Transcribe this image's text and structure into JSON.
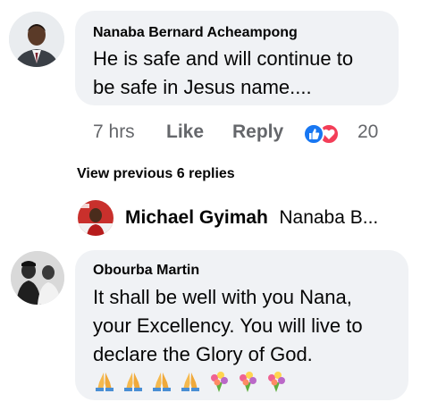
{
  "comment1": {
    "author": "Nanaba Bernard Acheampong",
    "line1": "He is safe and will continue to",
    "line2": "be safe in Jesus name....",
    "time": "7 hrs",
    "like": "Like",
    "reply": "Reply",
    "reaction_count": "20",
    "reaction_icons": [
      "like-icon",
      "love-icon"
    ]
  },
  "view_previous": "View previous 6 replies",
  "reply_preview": {
    "author": "Michael Gyimah",
    "snippet": "Nanaba B..."
  },
  "comment2": {
    "author": "Obourba Martin",
    "line1": "It shall be well with you Nana,",
    "line2": "your Excellency. You will live to",
    "line3": "declare the Glory of God.",
    "emojis": [
      "folded-hands",
      "folded-hands",
      "folded-hands",
      "folded-hands",
      "bouquet",
      "bouquet",
      "bouquet"
    ]
  },
  "colors": {
    "bubble": "#f0f2f5",
    "meta_text": "#65676b",
    "like_blue": "#1877f2",
    "love_red": "#f33e58"
  }
}
